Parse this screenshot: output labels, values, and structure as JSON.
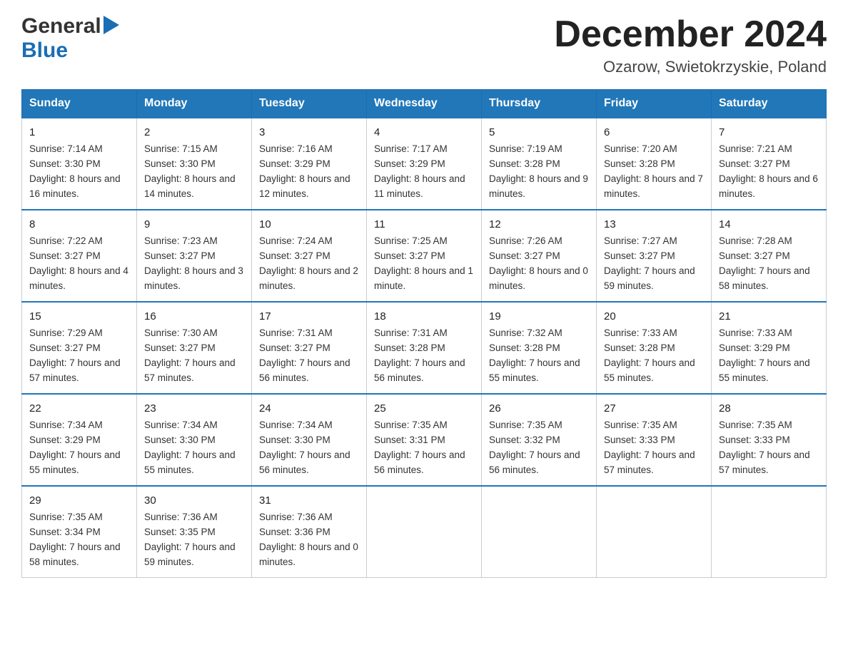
{
  "header": {
    "logo_general": "General",
    "logo_blue": "Blue",
    "month_year": "December 2024",
    "location": "Ozarow, Swietokrzyskie, Poland"
  },
  "days_of_week": [
    "Sunday",
    "Monday",
    "Tuesday",
    "Wednesday",
    "Thursday",
    "Friday",
    "Saturday"
  ],
  "weeks": [
    [
      {
        "day": "1",
        "sunrise": "7:14 AM",
        "sunset": "3:30 PM",
        "daylight": "8 hours and 16 minutes."
      },
      {
        "day": "2",
        "sunrise": "7:15 AM",
        "sunset": "3:30 PM",
        "daylight": "8 hours and 14 minutes."
      },
      {
        "day": "3",
        "sunrise": "7:16 AM",
        "sunset": "3:29 PM",
        "daylight": "8 hours and 12 minutes."
      },
      {
        "day": "4",
        "sunrise": "7:17 AM",
        "sunset": "3:29 PM",
        "daylight": "8 hours and 11 minutes."
      },
      {
        "day": "5",
        "sunrise": "7:19 AM",
        "sunset": "3:28 PM",
        "daylight": "8 hours and 9 minutes."
      },
      {
        "day": "6",
        "sunrise": "7:20 AM",
        "sunset": "3:28 PM",
        "daylight": "8 hours and 7 minutes."
      },
      {
        "day": "7",
        "sunrise": "7:21 AM",
        "sunset": "3:27 PM",
        "daylight": "8 hours and 6 minutes."
      }
    ],
    [
      {
        "day": "8",
        "sunrise": "7:22 AM",
        "sunset": "3:27 PM",
        "daylight": "8 hours and 4 minutes."
      },
      {
        "day": "9",
        "sunrise": "7:23 AM",
        "sunset": "3:27 PM",
        "daylight": "8 hours and 3 minutes."
      },
      {
        "day": "10",
        "sunrise": "7:24 AM",
        "sunset": "3:27 PM",
        "daylight": "8 hours and 2 minutes."
      },
      {
        "day": "11",
        "sunrise": "7:25 AM",
        "sunset": "3:27 PM",
        "daylight": "8 hours and 1 minute."
      },
      {
        "day": "12",
        "sunrise": "7:26 AM",
        "sunset": "3:27 PM",
        "daylight": "8 hours and 0 minutes."
      },
      {
        "day": "13",
        "sunrise": "7:27 AM",
        "sunset": "3:27 PM",
        "daylight": "7 hours and 59 minutes."
      },
      {
        "day": "14",
        "sunrise": "7:28 AM",
        "sunset": "3:27 PM",
        "daylight": "7 hours and 58 minutes."
      }
    ],
    [
      {
        "day": "15",
        "sunrise": "7:29 AM",
        "sunset": "3:27 PM",
        "daylight": "7 hours and 57 minutes."
      },
      {
        "day": "16",
        "sunrise": "7:30 AM",
        "sunset": "3:27 PM",
        "daylight": "7 hours and 57 minutes."
      },
      {
        "day": "17",
        "sunrise": "7:31 AM",
        "sunset": "3:27 PM",
        "daylight": "7 hours and 56 minutes."
      },
      {
        "day": "18",
        "sunrise": "7:31 AM",
        "sunset": "3:28 PM",
        "daylight": "7 hours and 56 minutes."
      },
      {
        "day": "19",
        "sunrise": "7:32 AM",
        "sunset": "3:28 PM",
        "daylight": "7 hours and 55 minutes."
      },
      {
        "day": "20",
        "sunrise": "7:33 AM",
        "sunset": "3:28 PM",
        "daylight": "7 hours and 55 minutes."
      },
      {
        "day": "21",
        "sunrise": "7:33 AM",
        "sunset": "3:29 PM",
        "daylight": "7 hours and 55 minutes."
      }
    ],
    [
      {
        "day": "22",
        "sunrise": "7:34 AM",
        "sunset": "3:29 PM",
        "daylight": "7 hours and 55 minutes."
      },
      {
        "day": "23",
        "sunrise": "7:34 AM",
        "sunset": "3:30 PM",
        "daylight": "7 hours and 55 minutes."
      },
      {
        "day": "24",
        "sunrise": "7:34 AM",
        "sunset": "3:30 PM",
        "daylight": "7 hours and 56 minutes."
      },
      {
        "day": "25",
        "sunrise": "7:35 AM",
        "sunset": "3:31 PM",
        "daylight": "7 hours and 56 minutes."
      },
      {
        "day": "26",
        "sunrise": "7:35 AM",
        "sunset": "3:32 PM",
        "daylight": "7 hours and 56 minutes."
      },
      {
        "day": "27",
        "sunrise": "7:35 AM",
        "sunset": "3:33 PM",
        "daylight": "7 hours and 57 minutes."
      },
      {
        "day": "28",
        "sunrise": "7:35 AM",
        "sunset": "3:33 PM",
        "daylight": "7 hours and 57 minutes."
      }
    ],
    [
      {
        "day": "29",
        "sunrise": "7:35 AM",
        "sunset": "3:34 PM",
        "daylight": "7 hours and 58 minutes."
      },
      {
        "day": "30",
        "sunrise": "7:36 AM",
        "sunset": "3:35 PM",
        "daylight": "7 hours and 59 minutes."
      },
      {
        "day": "31",
        "sunrise": "7:36 AM",
        "sunset": "3:36 PM",
        "daylight": "8 hours and 0 minutes."
      },
      null,
      null,
      null,
      null
    ]
  ],
  "labels": {
    "sunrise": "Sunrise: ",
    "sunset": "Sunset: ",
    "daylight": "Daylight: "
  }
}
